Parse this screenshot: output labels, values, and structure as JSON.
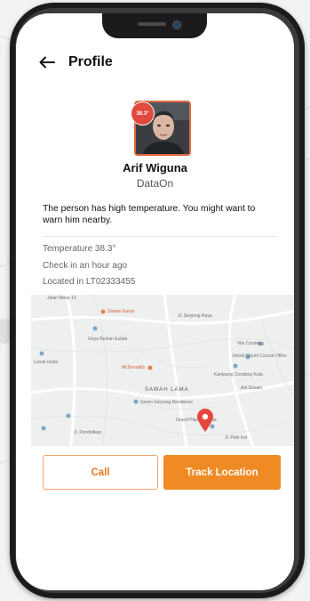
{
  "header": {
    "title": "Profile"
  },
  "profile": {
    "temperature_badge": "38.3°",
    "name": "Arif Wiguna",
    "company": "DataOn",
    "warning": "The person has high temperature. You might want to warn him nearby.",
    "details": {
      "temperature": "Temperature 38.3°",
      "check_in": "Check in an hour ago",
      "location": "Located in LT02333455"
    }
  },
  "map": {
    "labels": {
      "l1": "Jalan Mesa 13",
      "l2": "Zaman Karya",
      "l3": "Griya Berlian Estate",
      "l4": "Lunuk Gede",
      "l5": "McDonald's",
      "l6": "Vila Condeng",
      "l7": "Jinkrat Mount Course Office",
      "l8": "Kampung Condong Kota",
      "l9": "Aril Desain",
      "l10": "SAWAH LAMA",
      "l11": "Green Serpong Residence",
      "l12": "Grand Plaza's Dunia",
      "l13": "Jl. Pendidikan",
      "l14": "Jl. Petir Kel",
      "l15": "JI. Serpong Raya"
    },
    "pin_color": "#e8463b"
  },
  "actions": {
    "call_label": "Call",
    "track_label": "Track Location"
  },
  "colors": {
    "accent": "#ef8a24",
    "badge": "#e2483e"
  }
}
